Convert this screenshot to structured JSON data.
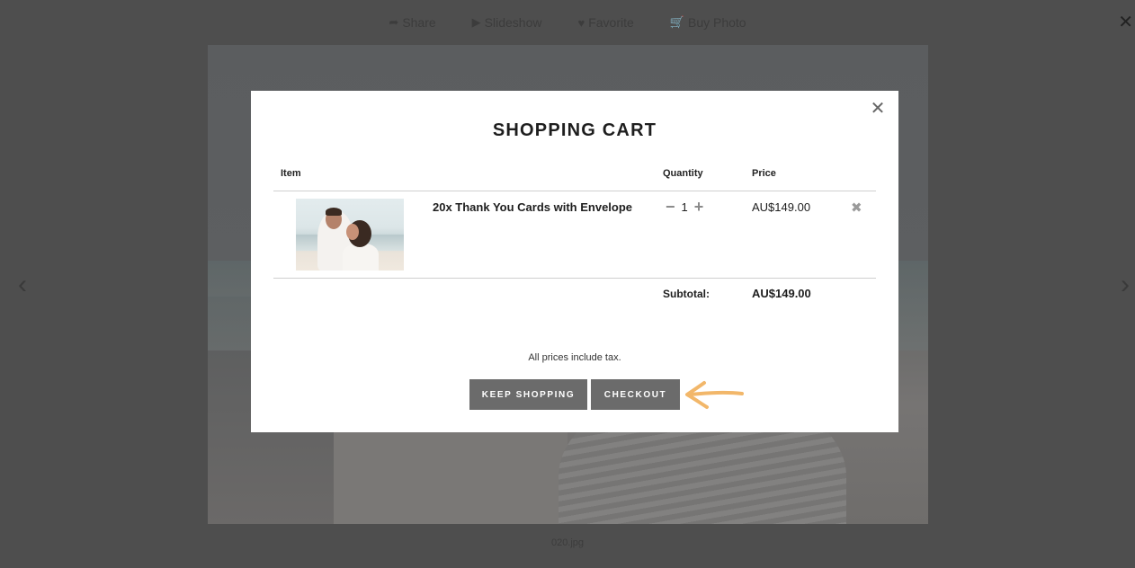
{
  "toolbar": {
    "share_label": "Share",
    "slideshow_label": "Slideshow",
    "favorite_label": "Favorite",
    "buy_photo_label": "Buy Photo",
    "close_glyph": "✕"
  },
  "lightbox": {
    "prev_glyph": "‹",
    "next_glyph": "›",
    "filename": "020.jpg"
  },
  "cart": {
    "title": "SHOPPING CART",
    "close_glyph": "✕",
    "headers": {
      "item": "Item",
      "quantity": "Quantity",
      "price": "Price"
    },
    "items": [
      {
        "name": "20x Thank You Cards with Envelope",
        "quantity": "1",
        "price": "AU$149.00",
        "minus_glyph": "−",
        "plus_glyph": "+",
        "remove_glyph": "✖"
      }
    ],
    "subtotal_label": "Subtotal:",
    "subtotal_value": "AU$149.00",
    "tax_note": "All prices include tax.",
    "keep_shopping_label": "KEEP SHOPPING",
    "checkout_label": "CHECKOUT"
  },
  "colors": {
    "overlay": "#4e4e4e",
    "button_bg": "#6b6b6b",
    "annotation_arrow": "#f2b76a"
  },
  "icons": [
    "share-icon",
    "play-icon",
    "heart-icon",
    "cart-icon",
    "close-icon",
    "minus-icon",
    "plus-icon",
    "remove-icon",
    "arrow-annotation"
  ]
}
